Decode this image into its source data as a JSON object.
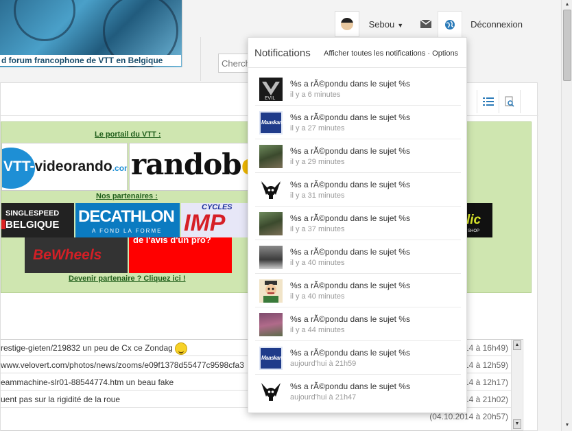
{
  "header": {
    "banner_tagline": "d forum francophone de VTT en Belgique",
    "user_name": "Sebou",
    "logout_label": "Déconnexion",
    "search_placeholder": "Cherch"
  },
  "partners": {
    "portal_title": "Le portail du VTT :",
    "partners_title": "Nos partenaires :",
    "become_partner": "Devenir partenaire ? Cliquez ici !",
    "logos": {
      "vtt_main": "VTT-",
      "vtt_rest": "videorando",
      "vtt_com": ".com",
      "rando": "randob",
      "rando_tail": "e",
      "singlespeed_1": "SINGLESPEED",
      "singlespeed_2": "BELGIQUE",
      "decathlon": "DECATHLON",
      "decathlon_tag": "A FOND LA FORME",
      "cycles": "CYCLES",
      "impact": "IMP",
      "right_logo": "lic",
      "right_logo_sub": "SHOP",
      "bewheels": "BeWheels",
      "avis": "de l'avis d'un pro?"
    }
  },
  "shoutbox": {
    "rows": [
      {
        "msg": "restige-gieten/219832 un peu de Cx ce Zondag",
        "date": "14 à 16h49)",
        "smiley": true
      },
      {
        "msg": "www.velovert.com/photos/news/zooms/e09f1378d55477c9598cfa3",
        "date": "14 à 12h59)",
        "smiley": false
      },
      {
        "msg": "eammachine-slr01-88544774.htm un beau fake",
        "date": "14 à 12h17)",
        "smiley": false
      },
      {
        "msg": "uent pas sur la rigidité de la roue",
        "date": "14 à 21h02)",
        "smiley": false
      },
      {
        "msg": "",
        "date": "(04.10.2014 à 20h57)",
        "smiley": false
      }
    ]
  },
  "notifications": {
    "title": "Notifications",
    "links": "Afficher toutes les notifications · Options",
    "items": [
      {
        "text": "%s a rÃ©pondu dans le sujet %s",
        "time": "il y a 6 minutes",
        "avatar": "evil-avatar"
      },
      {
        "text": "%s a rÃ©pondu dans le sujet %s",
        "time": "il y a 27 minutes",
        "avatar": "maaskantje-avatar"
      },
      {
        "text": "%s a rÃ©pondu dans le sujet %s",
        "time": "il y a 29 minutes",
        "avatar": "bike-photo-avatar"
      },
      {
        "text": "%s a rÃ©pondu dans le sujet %s",
        "time": "il y a 31 minutes",
        "avatar": "skull-wings-avatar"
      },
      {
        "text": "%s a rÃ©pondu dans le sujet %s",
        "time": "il y a 37 minutes",
        "avatar": "bike-photo-avatar"
      },
      {
        "text": "%s a rÃ©pondu dans le sujet %s",
        "time": "il y a 40 minutes",
        "avatar": "rider-photo-avatar"
      },
      {
        "text": "%s a rÃ©pondu dans le sujet %s",
        "time": "il y a 40 minutes",
        "avatar": "cartoon-avatar"
      },
      {
        "text": "%s a rÃ©pondu dans le sujet %s",
        "time": "il y a 44 minutes",
        "avatar": "mud-photo-avatar"
      },
      {
        "text": "%s a rÃ©pondu dans le sujet %s",
        "time": "aujourd'hui à 21h59",
        "avatar": "maaskantje-avatar"
      },
      {
        "text": "%s a rÃ©pondu dans le sujet %s",
        "time": "aujourd'hui à 21h47",
        "avatar": "skull-wings-avatar"
      }
    ]
  },
  "colors": {
    "partner_bg": "#cfe6b0",
    "link_green": "#1f5e1a",
    "accent_blue": "#2a7ab8"
  }
}
